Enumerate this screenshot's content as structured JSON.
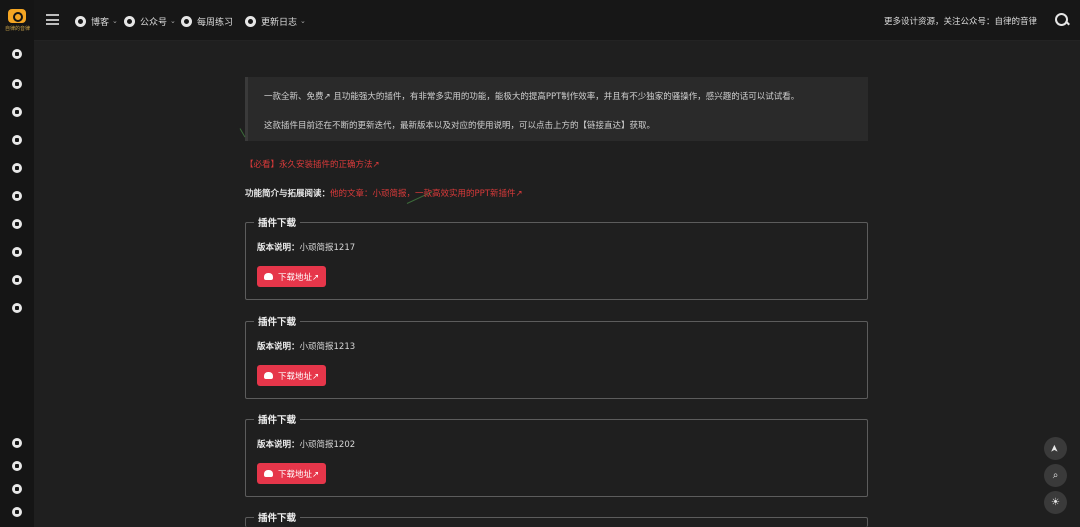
{
  "logo": {
    "text": "自律的音律"
  },
  "nav": {
    "items": [
      {
        "label": "博客",
        "caret": "⌄"
      },
      {
        "label": "公众号",
        "caret": "⌄"
      },
      {
        "label": "每周练习",
        "caret": ""
      },
      {
        "label": "更新日志",
        "caret": "⌄"
      }
    ],
    "right_text": "更多设计资源，关注公众号：自律的音律"
  },
  "quote": {
    "line1": "一款全新、免费↗ 且功能强大的插件，有非常多实用的功能，能极大的提高PPT制作效率，并且有不少独家的骚操作，感兴趣的话可以试试看。",
    "line2": "这款插件目前还在不断的更新迭代，最新版本以及对应的使用说明，可以点击上方的【链接直达】获取。"
  },
  "must_read": "【必看】永久安装插件的正确方法↗",
  "intro": {
    "label": "功能简介与拓展阅读：",
    "link": "他的文章：小顽简报，一款高效实用的PPT新插件↗"
  },
  "downloads": [
    {
      "legend": "插件下载",
      "version_label": "版本说明：",
      "version": "小顽简报1217",
      "button": "下载地址↗"
    },
    {
      "legend": "插件下载",
      "version_label": "版本说明：",
      "version": "小顽简报1213",
      "button": "下载地址↗"
    },
    {
      "legend": "插件下载",
      "version_label": "版本说明：",
      "version": "小顽简报1202",
      "button": "下载地址↗"
    },
    {
      "legend": "插件下载"
    }
  ],
  "fab": {
    "up": "➤",
    "search": "⌕",
    "theme": "☀"
  },
  "colors": {
    "accent": "#e6364a",
    "link_red": "#d93a3a",
    "logo": "#f5a623"
  }
}
